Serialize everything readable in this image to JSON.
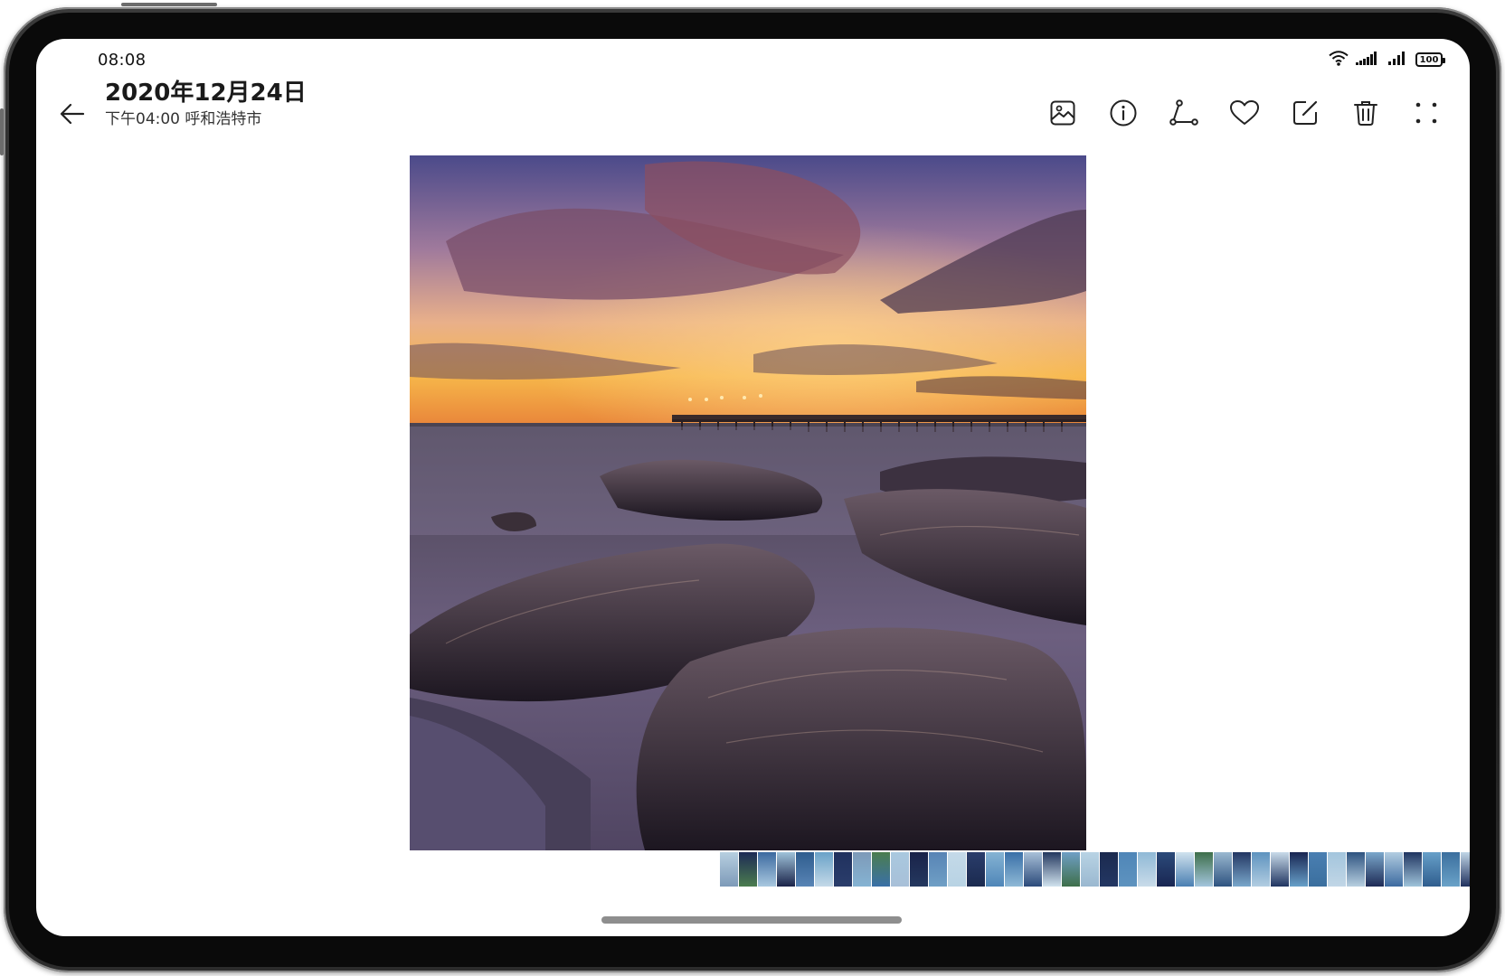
{
  "status_bar": {
    "time": "08:08",
    "battery": "100",
    "icons": [
      "wifi-icon",
      "signal-icon",
      "signal-icon",
      "battery-icon"
    ]
  },
  "header": {
    "back_icon": "arrow-left-icon",
    "title": "2020年12月24日",
    "subtitle": "下午04:00 呼和浩特市"
  },
  "toolbar": {
    "buttons": [
      {
        "name": "image",
        "icon": "image-icon"
      },
      {
        "name": "info",
        "icon": "info-icon"
      },
      {
        "name": "share",
        "icon": "share-icon"
      },
      {
        "name": "favorite",
        "icon": "heart-icon"
      },
      {
        "name": "edit",
        "icon": "edit-icon"
      },
      {
        "name": "delete",
        "icon": "trash-icon"
      },
      {
        "name": "more",
        "icon": "more-icon"
      }
    ]
  },
  "photo": {
    "subject": "long-exposure seascape with rocks, pier and sunset sky"
  },
  "filmstrip": {
    "thumbnail_palette": [
      "#b7cfe0",
      "#1d2a55",
      "#3c6aa0",
      "#9fc3da",
      "#2f5d8e",
      "#6aa2c8",
      "#20315e",
      "#7d9ab8",
      "#4b7d4f",
      "#a9c8df",
      "#1a2349",
      "#5884b5",
      "#c4d9e8",
      "#2a3d6b",
      "#85b3d3",
      "#3a70a8",
      "#a8c0d8",
      "#24385f",
      "#6f9fc5",
      "#b8d3e4",
      "#1b2a4f",
      "#4f86b8",
      "#8fb9d6",
      "#2b4a7a",
      "#d0e2ee",
      "#3e6f4a",
      "#9ab8d0",
      "#233763",
      "#5e93bf",
      "#c9dbe9",
      "#192652",
      "#4a7fb2",
      "#a3c5dd",
      "#2e5380",
      "#7aa7cb",
      "#b2cde1",
      "#203561",
      "#67a0c9",
      "#3b6f9e",
      "#c1d6e6"
    ]
  },
  "colors": {
    "background": "#ffffff",
    "frame": "#1b1b1b",
    "text": "#1a1a1a",
    "home_indicator": "#8e8e8e"
  }
}
